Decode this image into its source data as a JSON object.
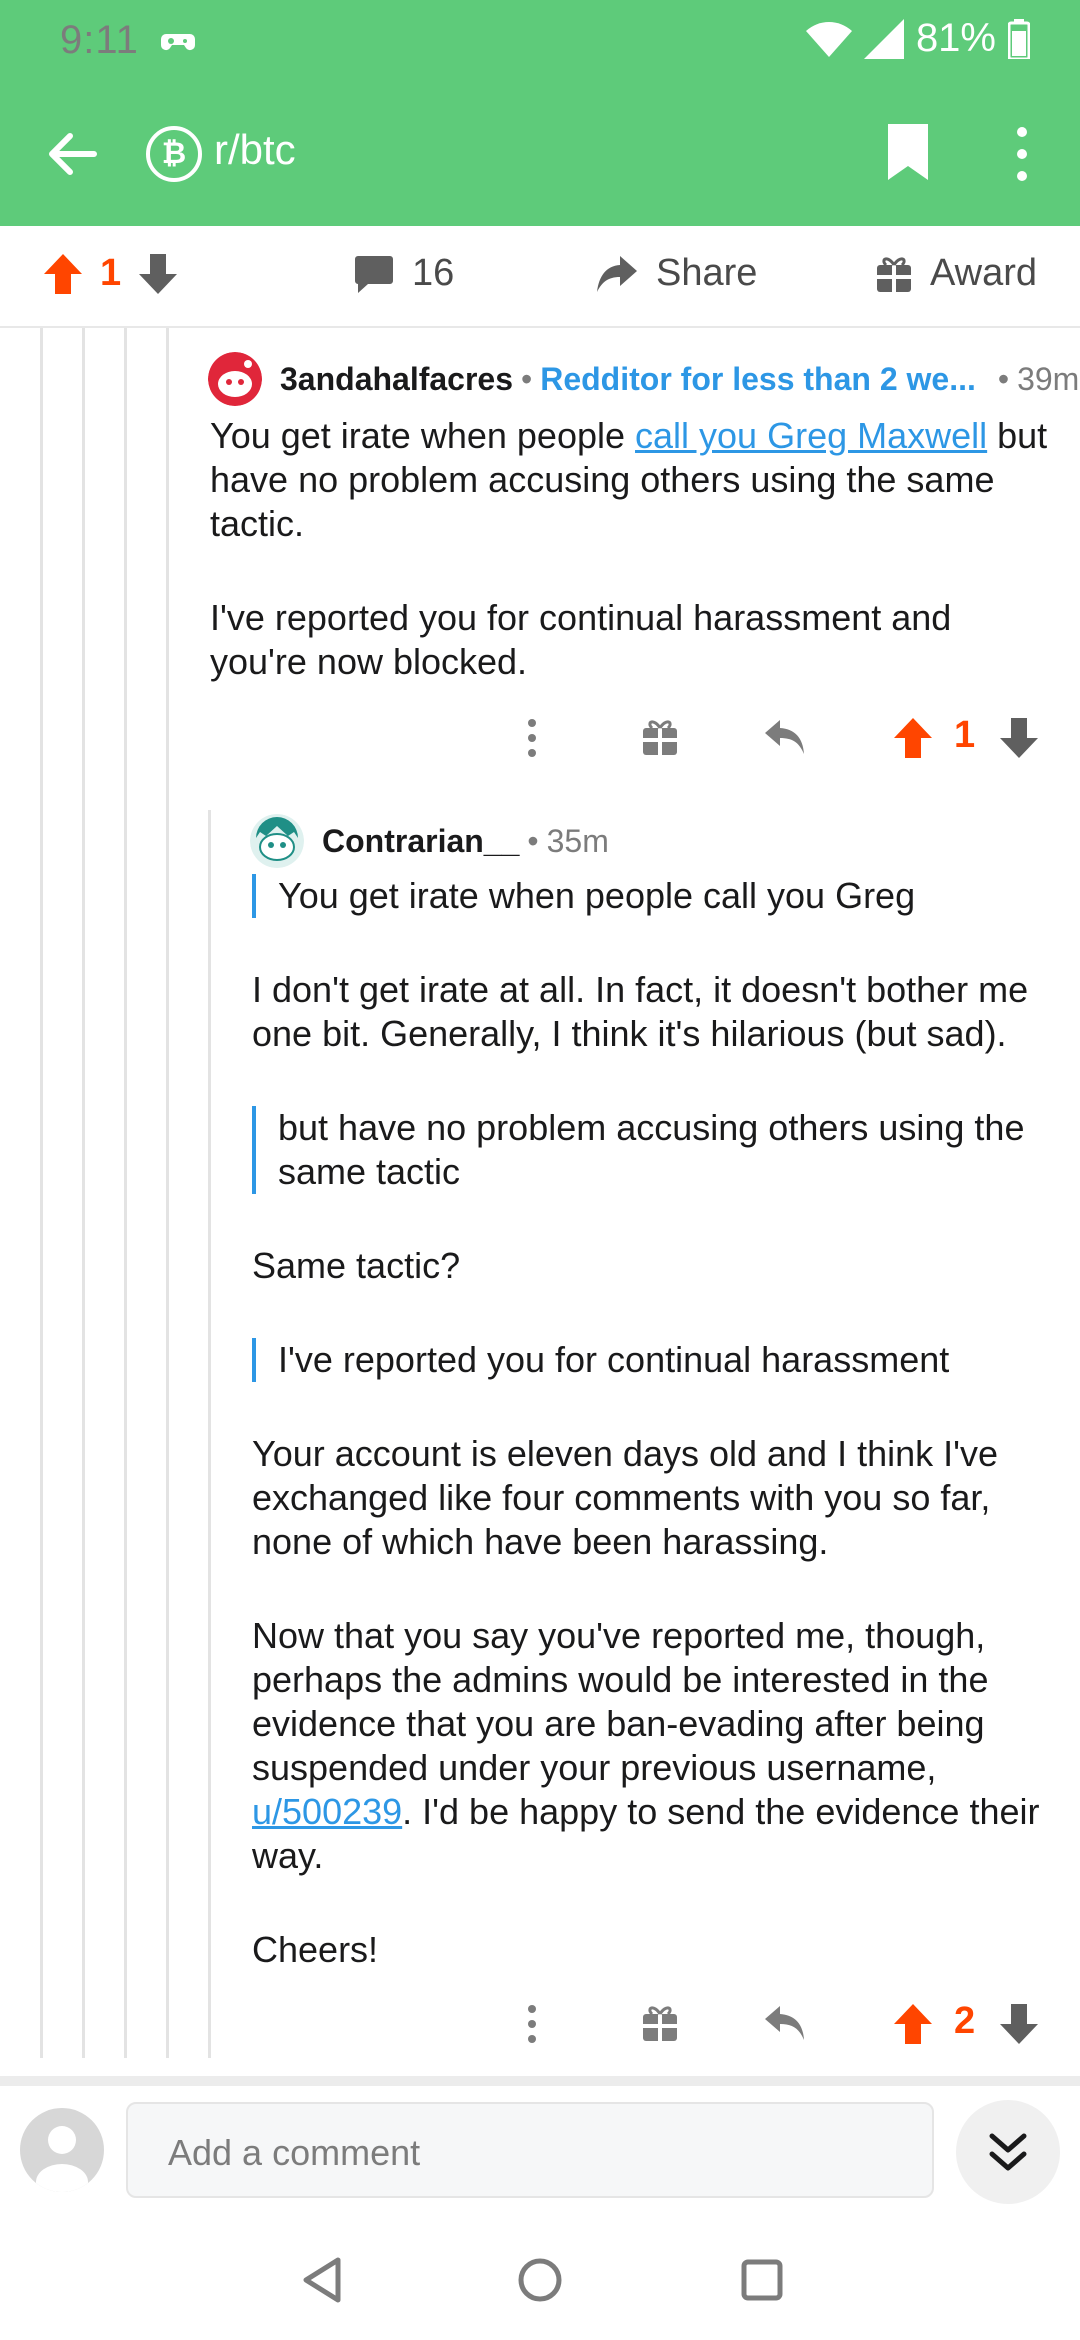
{
  "status_bar": {
    "time": "9:11",
    "battery": "81%"
  },
  "app_bar": {
    "subreddit": "r/btc",
    "subreddit_icon": "bitcoin-icon"
  },
  "post_bar": {
    "upvotes": "1",
    "comments": "16",
    "share_label": "Share",
    "award_label": "Award"
  },
  "comment1": {
    "author": "3andahalfacres",
    "flair": "Redditor for less than 2 we...",
    "time": "39m",
    "body": {
      "p1_pre": "You get irate when people ",
      "p1_link": "call you Greg Maxwell",
      "p1_post": " but have no problem accusing others using the same tactic.",
      "p2": "I've reported you for continual harassment and you're now blocked."
    },
    "score": "1"
  },
  "comment2": {
    "author": "Contrarian__",
    "time": "35m",
    "body": {
      "quote1": "You get irate when people call you Greg",
      "p1": "I don't get irate at all. In fact, it doesn't bother me one bit. Generally, I think it's hilarious (but sad).",
      "quote2": "but have no problem accusing others using the same tactic",
      "p2": "Same tactic?",
      "quote3": "I've reported you for continual harassment",
      "p3": "Your account is eleven days old and I think I've exchanged like four comments with you so far, none of which have been harassing.",
      "p4_pre": "Now that you say you've reported me, though, perhaps the admins would be interested in the evidence that you are ban-evading after being suspended under your previous username, ",
      "p4_link": "u/500239",
      "p4_post": ". I'd be happy to send the evidence their way.",
      "p5": "Cheers!"
    },
    "score": "2"
  },
  "composer": {
    "placeholder": "Add a comment"
  },
  "colors": {
    "brand_green": "#5ecb7a",
    "upvote_orange": "#ff4500",
    "link_blue": "#2d97e5"
  }
}
